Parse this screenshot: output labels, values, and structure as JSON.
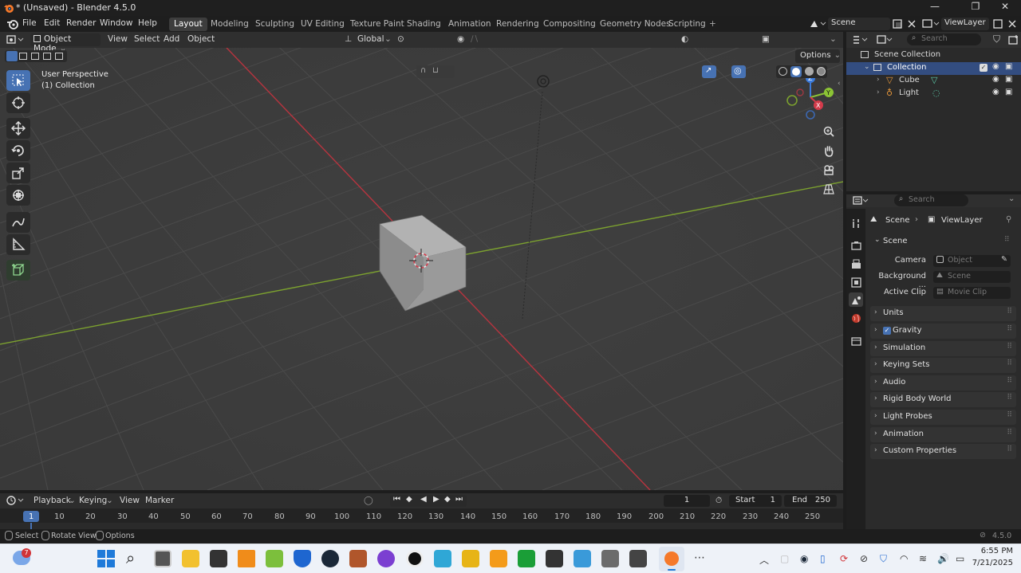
{
  "window": {
    "title": "* (Unsaved) - Blender 4.5.0",
    "controls": [
      "—",
      "❐",
      "✕"
    ]
  },
  "menu": [
    "File",
    "Edit",
    "Render",
    "Window",
    "Help"
  ],
  "workspaces": [
    "Layout",
    "Modeling",
    "Sculpting",
    "UV Editing",
    "Texture Paint",
    "Shading",
    "Animation",
    "Rendering",
    "Compositing",
    "Geometry Nodes",
    "Scripting",
    "+"
  ],
  "active_workspace": "Layout",
  "scene_selector": "Scene",
  "viewlayer_selector": "ViewLayer",
  "viewport": {
    "mode": "Object Mode",
    "menus": [
      "View",
      "Select",
      "Add",
      "Object"
    ],
    "orientation": "Global",
    "options_label": "Options",
    "overlay_title": "User Perspective",
    "overlay_subtitle": "(1) Collection",
    "gizmo_axes": [
      "X",
      "Y",
      "Z"
    ],
    "tools": [
      "select-box",
      "cursor",
      "move",
      "rotate",
      "scale",
      "transform",
      "annotate",
      "measure",
      "add-cube"
    ]
  },
  "outliner": {
    "search_placeholder": "Search",
    "root": "Scene Collection",
    "collection": "Collection",
    "items": [
      {
        "label": "Cube",
        "icon": "mesh-icon"
      },
      {
        "label": "Light",
        "icon": "light-icon"
      }
    ]
  },
  "properties": {
    "search_placeholder": "Search",
    "breadcrumb": [
      "Scene",
      "ViewLayer"
    ],
    "section": "Scene",
    "fields": [
      {
        "label": "Camera",
        "placeholder": "Object"
      },
      {
        "label": "Background ...",
        "placeholder": "Scene"
      },
      {
        "label": "Active Clip",
        "placeholder": "Movie Clip"
      }
    ],
    "panels": [
      "Units",
      "Gravity",
      "Simulation",
      "Keying Sets",
      "Audio",
      "Rigid Body World",
      "Light Probes",
      "Animation",
      "Custom Properties"
    ]
  },
  "timeline": {
    "menus": [
      "Playback",
      "Keying",
      "View",
      "Marker"
    ],
    "current_frame": "1",
    "start_label": "Start",
    "start_value": "1",
    "end_label": "End",
    "end_value": "250",
    "ticks": [
      "1",
      "10",
      "20",
      "30",
      "40",
      "50",
      "60",
      "70",
      "80",
      "90",
      "100",
      "110",
      "120",
      "130",
      "140",
      "150",
      "160",
      "170",
      "180",
      "190",
      "200",
      "210",
      "220",
      "230",
      "240",
      "250"
    ]
  },
  "statusbar": {
    "hints": [
      "Select",
      "Rotate View",
      "Options"
    ],
    "version": "4.5.0"
  },
  "taskbar": {
    "notification_badge": "7",
    "time": "6:55 PM",
    "date": "7/21/2025"
  },
  "colors": {
    "accent": "#4772b3",
    "x_axis": "#d43b4b",
    "y_axis": "#8cc435",
    "z_axis": "#3c7cdc"
  }
}
